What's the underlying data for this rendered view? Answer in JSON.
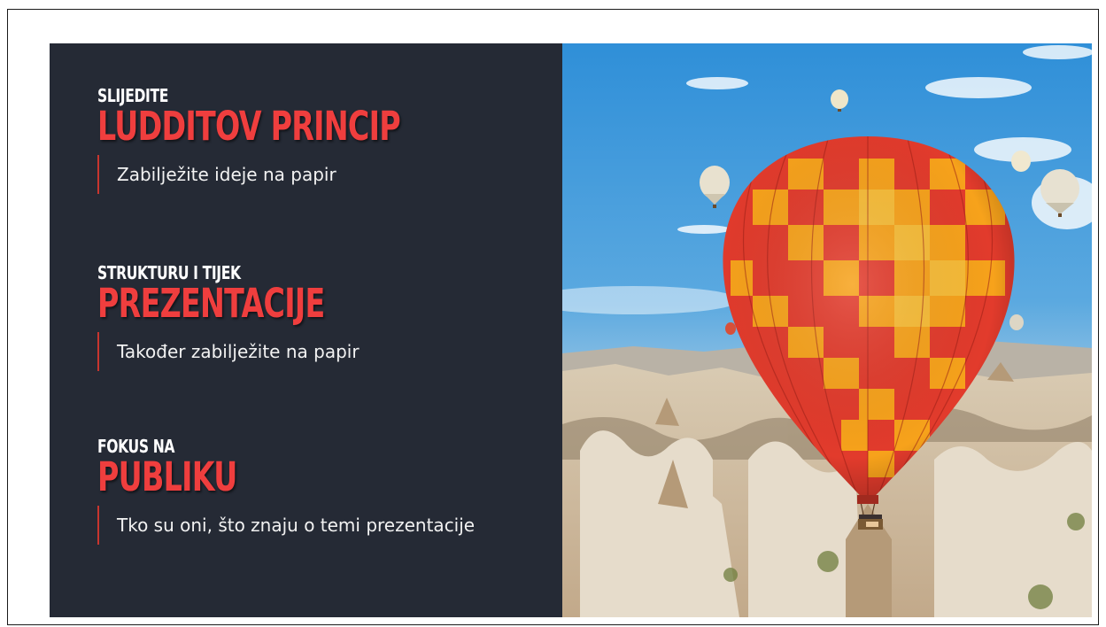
{
  "sections": [
    {
      "kicker": "SLIJEDITE",
      "headline": "LUDDITOV PRINCIP",
      "note": "Zabilježite ideje na papir"
    },
    {
      "kicker": "STRUKTURU I TIJEK",
      "headline": "PREZENTACIJE",
      "note": "Također zabilježite na papir"
    },
    {
      "kicker": "FOKUS NA",
      "headline": "PUBLIKU",
      "note": "Tko su oni, što znaju o temi prezentacije"
    }
  ],
  "colors": {
    "panel_bg": "#252a35",
    "accent": "#ef3e3e",
    "accent_bar": "#c8352f",
    "text": "#f2f2f2"
  },
  "image": {
    "subject": "hot-air-balloons-over-rock-valley"
  }
}
